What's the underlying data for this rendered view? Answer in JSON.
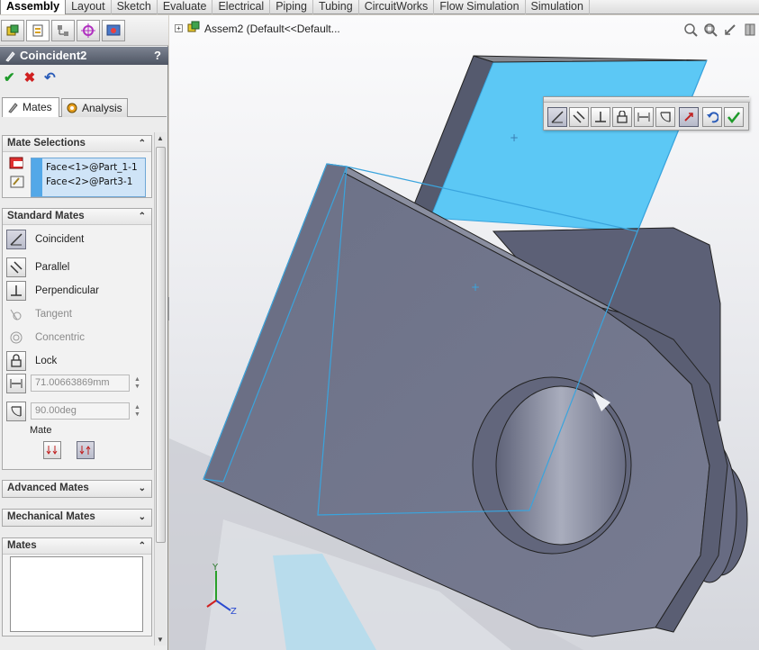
{
  "tabs": [
    "Assembly",
    "Layout",
    "Sketch",
    "Evaluate",
    "Electrical",
    "Piping",
    "Tubing",
    "CircuitWorks",
    "Flow Simulation",
    "Simulation"
  ],
  "active_tab": "Assembly",
  "property_manager": {
    "title": "Coincident2",
    "help": "?",
    "sub_tabs": [
      "Mates",
      "Analysis"
    ],
    "mate_selections": {
      "heading": "Mate Selections",
      "items": [
        "Face<1>@Part_1-1",
        "Face<2>@Part3-1"
      ]
    },
    "standard_mates": {
      "heading": "Standard Mates",
      "coincident": "Coincident",
      "parallel": "Parallel",
      "perpendicular": "Perpendicular",
      "tangent": "Tangent",
      "concentric": "Concentric",
      "lock": "Lock",
      "distance_value": "71.00663869mm",
      "angle_value": "90.00deg",
      "mate_alignment_label": "Mate"
    },
    "advanced_mates": "Advanced Mates",
    "mechanical_mates": "Mechanical Mates",
    "mates": "Mates"
  },
  "viewport": {
    "tree_label": "Assem2  (Default<<Default...",
    "triad": {
      "y": "Y",
      "z": "Z"
    }
  },
  "colors": {
    "selection_blue": "#5cc8f5",
    "part_gray": "#7c8196",
    "title_bar": "#5a6170"
  }
}
